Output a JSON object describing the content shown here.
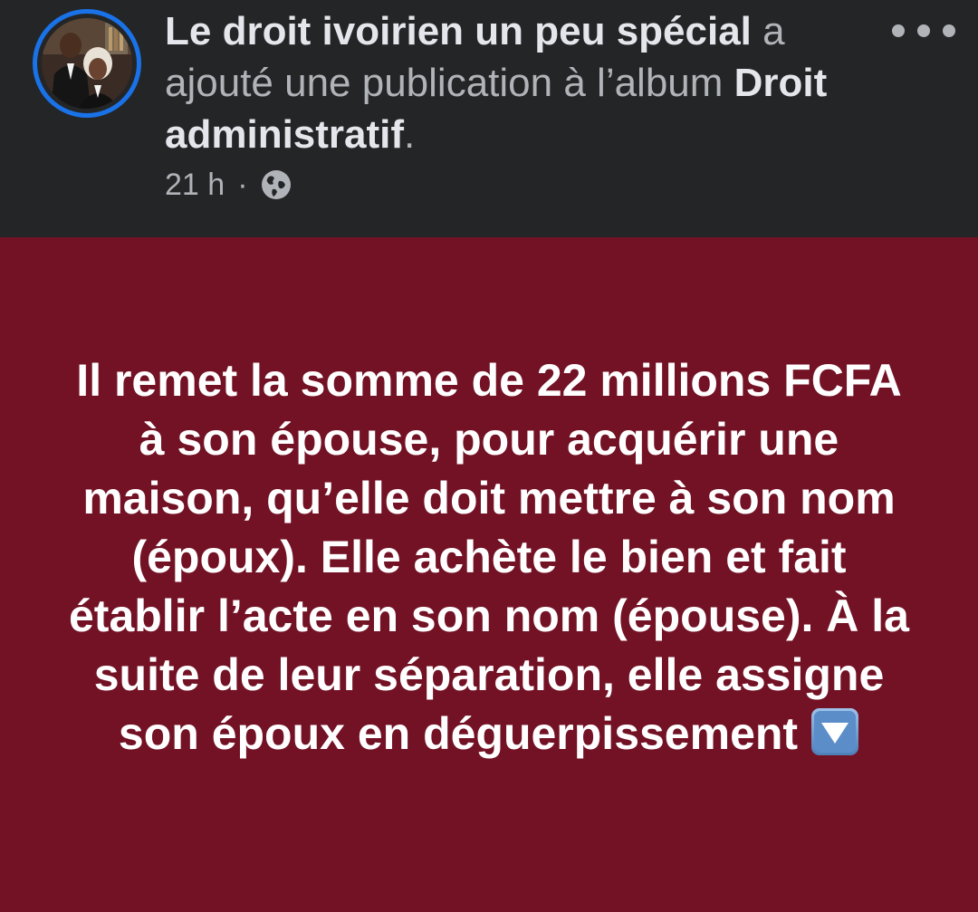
{
  "post": {
    "author": "Le droit ivoirien un peu spécial",
    "action_text": " a ajouté une publication à l’album ",
    "album": "Droit administratif",
    "period": ".",
    "time": "21 h",
    "separator": "·",
    "privacy_icon": "globe-icon",
    "more_icon": "more-dots-icon",
    "avatar_icon": "profile-photo"
  },
  "content": {
    "text": "Il remet la somme de 22 millions FCFA à son épouse, pour acquérir une maison, qu’elle doit mettre à son nom (époux). Elle achète le bien et fait établir l’acte en son nom (épouse). À la suite de leur séparation, elle assigne son époux en déguerpissement",
    "emoji": "down-arrow-button-emoji"
  },
  "colors": {
    "header_bg": "#242526",
    "post_bg": "#731225",
    "avatar_ring": "#1a72e8",
    "text_primary": "#e4e6eb",
    "text_secondary": "#b0b3b8"
  }
}
